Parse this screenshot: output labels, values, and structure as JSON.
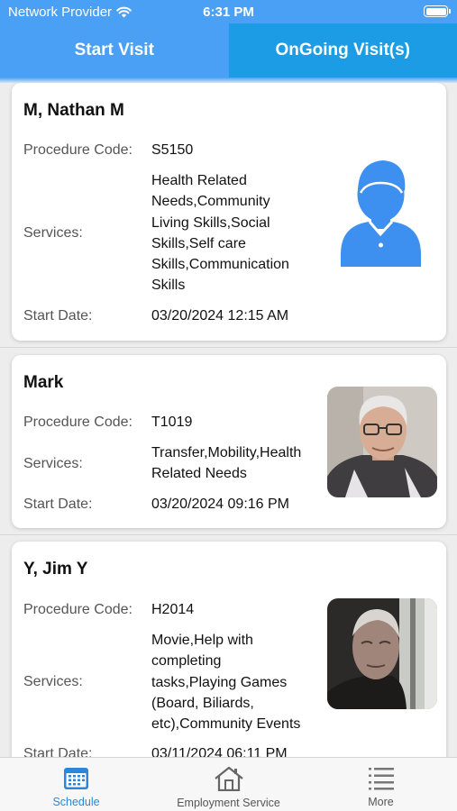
{
  "status_bar": {
    "carrier": "Network Provider",
    "time": "6:31 PM"
  },
  "tabs": [
    {
      "label": "Start Visit"
    },
    {
      "label": "OnGoing Visit(s)"
    }
  ],
  "labels": {
    "procedure_code": "Procedure Code:",
    "services": "Services:",
    "start_date": "Start Date:"
  },
  "visits": [
    {
      "name": "M, Nathan M",
      "procedure_code": "S5150",
      "services_lines": [
        "Health Related",
        "Needs,Community",
        "Living Skills,Social",
        "Skills,Self care",
        "Skills,Communication",
        "Skills"
      ],
      "start_date": "03/20/2024 12:15 AM",
      "photo": "default-avatar-icon"
    },
    {
      "name": "Mark",
      "procedure_code": "T1019",
      "services_lines": [
        "Transfer,Mobility,Health",
        "Related Needs"
      ],
      "start_date": "03/20/2024 09:16 PM",
      "photo": "elderly-man-with-glasses-photo"
    },
    {
      "name": "Y, Jim Y",
      "procedure_code": "H2014",
      "services_lines": [
        "Movie,Help with",
        "completing",
        "tasks,Playing Games",
        "(Board, Biliards,",
        "etc),Community Events"
      ],
      "start_date": "03/11/2024 06:11 PM",
      "photo": "elderly-man-by-window-photo"
    }
  ],
  "bottom_nav": [
    {
      "label": "Schedule",
      "icon": "calendar-icon",
      "active": true
    },
    {
      "label": "Employment Service",
      "icon": "home-icon",
      "active": false
    },
    {
      "label": "More",
      "icon": "menu-list-icon",
      "active": false
    }
  ],
  "colors": {
    "primary": "#4aa0f5",
    "tab_active": "#1b9ce4",
    "avatar_blue": "#3d8ff0",
    "nav_active": "#2c86d9"
  }
}
